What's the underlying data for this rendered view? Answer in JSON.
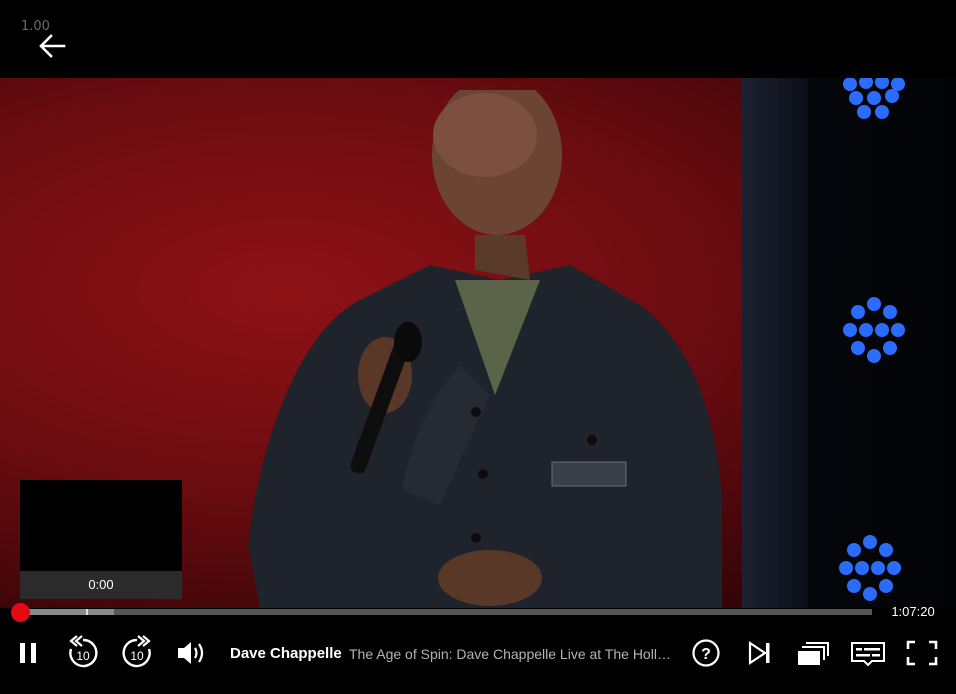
{
  "app": {
    "version": "1.00",
    "accent_color": "#e50914"
  },
  "header": {
    "back_icon": "arrow-left-icon"
  },
  "player": {
    "preview_time": "0:00",
    "duration": "1:07:20",
    "progress_fraction": 0.0,
    "buffered_fraction": 0.11,
    "hover_fraction": 0.078
  },
  "controls": {
    "icons": [
      "pause-icon",
      "rewind-10-icon",
      "forward-10-icon",
      "volume-icon",
      "help-icon",
      "next-episode-icon",
      "episodes-icon",
      "subtitles-icon",
      "fullscreen-icon"
    ],
    "rewind_label": "10",
    "forward_label": "10",
    "help_label": "?"
  },
  "title": {
    "show": "Dave Chappelle",
    "episode": "The Age of Spin: Dave Chappelle Live at The Hollywood Palladium"
  }
}
